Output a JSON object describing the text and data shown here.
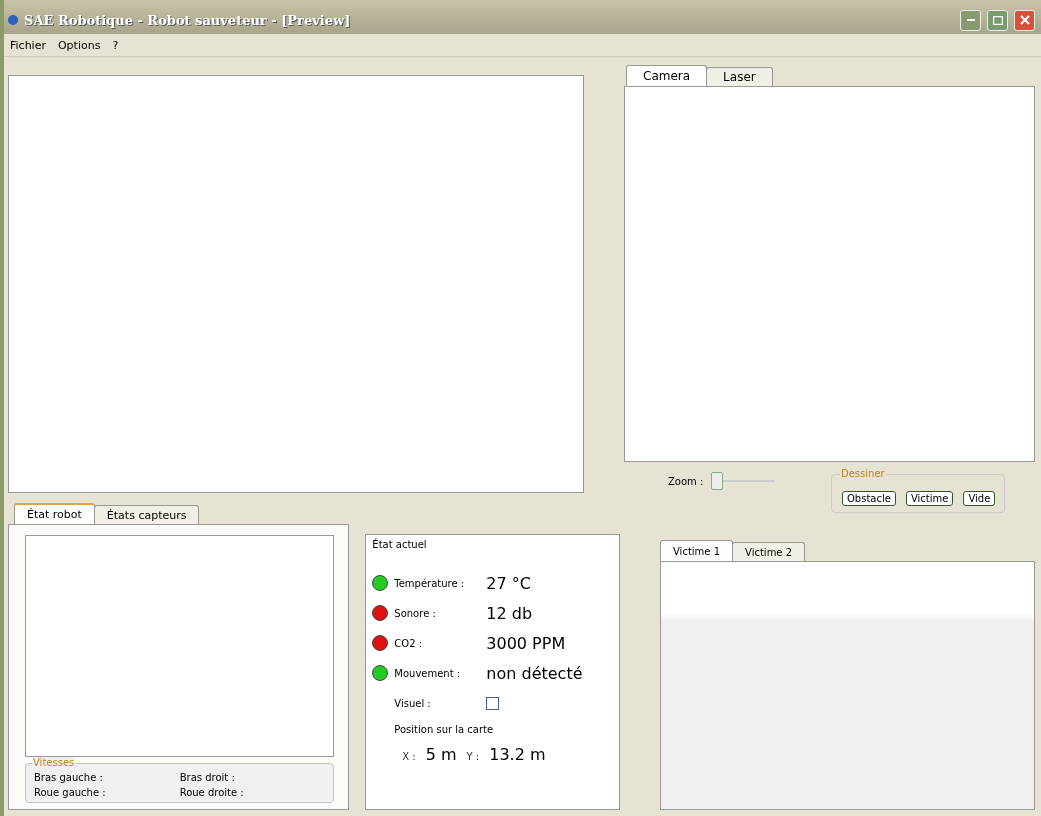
{
  "window": {
    "title": "SAE Robotique - Robot sauveteur - [Preview]"
  },
  "menu": [
    "Fichier",
    "Options",
    "?"
  ],
  "view_tabs": [
    {
      "label": "Camera",
      "selected": true
    },
    {
      "label": "Laser",
      "selected": false
    }
  ],
  "zoom": {
    "label": "Zoom :",
    "level": 0
  },
  "draw_group": {
    "title": "Dessiner",
    "buttons": [
      "Obstacle",
      "Victime",
      "Vide"
    ]
  },
  "robot_tabs": [
    {
      "label": "État robot",
      "selected": true
    },
    {
      "label": "États capteurs",
      "selected": false
    }
  ],
  "speeds": {
    "title": "Vitesses",
    "items": [
      "Bras gauche :",
      "Bras droit :",
      "Roue gauche :",
      "Roue droite :"
    ]
  },
  "state": {
    "title": "État actuel",
    "sensors": [
      {
        "label": "Température :",
        "value": "27 °C",
        "color": "#22cc22"
      },
      {
        "label": "Sonore :",
        "value": "12 db",
        "color": "#dd1111"
      },
      {
        "label": "CO2 :",
        "value": "3000 PPM",
        "color": "#dd1111"
      },
      {
        "label": "Mouvement :",
        "value": "non détecté",
        "color": "#22cc22"
      }
    ],
    "visual": {
      "label": "Visuel :",
      "checked": false
    },
    "position": {
      "title": "Position sur la carte",
      "x_label": "X :",
      "x": "5 m",
      "y_label": "Y :",
      "y": "13.2 m"
    }
  },
  "victim_tabs": [
    {
      "label": "Victime 1",
      "selected": true
    },
    {
      "label": "Victime 2",
      "selected": false
    }
  ]
}
